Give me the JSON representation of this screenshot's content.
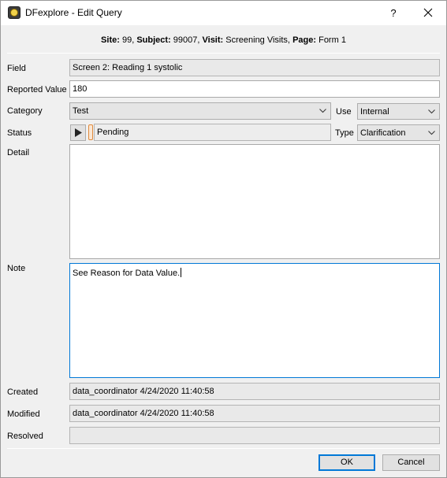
{
  "window": {
    "title": "DFexplore - Edit Query",
    "help_label": "?"
  },
  "header": {
    "site_label": "Site:",
    "site_value": "99,",
    "subject_label": "Subject:",
    "subject_value": "99007,",
    "visit_label": "Visit:",
    "visit_value": "Screening Visits,",
    "page_label": "Page:",
    "page_value": "Form 1"
  },
  "form": {
    "field_label": "Field",
    "field_value": "Screen 2: Reading 1 systolic",
    "reported_label": "Reported Value",
    "reported_value": "180",
    "category_label": "Category",
    "category_value": "Test",
    "use_label": "Use",
    "use_value": "Internal",
    "status_label": "Status",
    "status_value": "Pending",
    "type_label": "Type",
    "type_value": "Clarification",
    "detail_label": "Detail",
    "detail_value": "",
    "note_label": "Note",
    "note_value": "See Reason for Data Value.",
    "created_label": "Created",
    "created_value": "data_coordinator 4/24/2020 11:40:58",
    "modified_label": "Modified",
    "modified_value": "data_coordinator 4/24/2020 11:40:58",
    "resolved_label": "Resolved",
    "resolved_value": ""
  },
  "buttons": {
    "ok": "OK",
    "cancel": "Cancel"
  },
  "colors": {
    "status_pending": "#e08a3c",
    "focus_border": "#0078d7"
  },
  "icons": {
    "app": "dfexplore-app-icon",
    "close": "close-icon",
    "status_play": "play-icon",
    "dropdown": "chevron-down-icon"
  }
}
